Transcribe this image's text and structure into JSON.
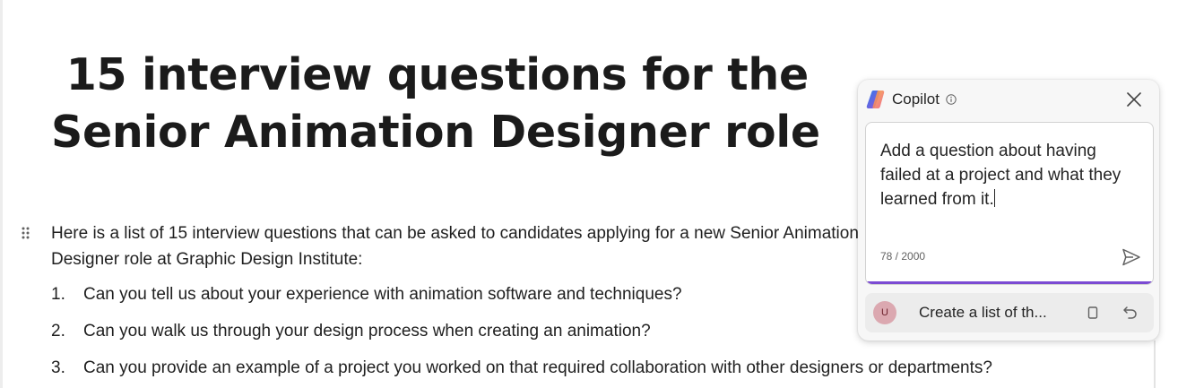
{
  "document": {
    "title": " 15 interview questions for the Senior Animation Designer role",
    "intro": "Here is a list of 15 interview questions that can be asked to candidates applying for a new Senior Animation Designer role at Graphic Design Institute:",
    "questions": [
      {
        "number": "1.",
        "text": "Can you tell us about your experience with animation software and techniques?"
      },
      {
        "number": "2.",
        "text": "Can you walk us through your design process when creating an animation?"
      },
      {
        "number": "3.",
        "text": "Can you provide an example of a project you worked on that required collaboration with other designers or departments?"
      }
    ]
  },
  "copilot": {
    "title": "Copilot",
    "icons": {
      "logo": "copilot-logo-icon",
      "info": "info-icon",
      "close": "close-icon",
      "send": "send-icon",
      "copy": "copy-icon",
      "undo": "undo-icon"
    },
    "prompt": "Add a question about having failed at a project and what they learned from it.",
    "char_count": "78 / 2000",
    "history": {
      "avatar_initial": "U",
      "text": "Create a list of th..."
    },
    "accent_color": "#7b4bd3"
  }
}
